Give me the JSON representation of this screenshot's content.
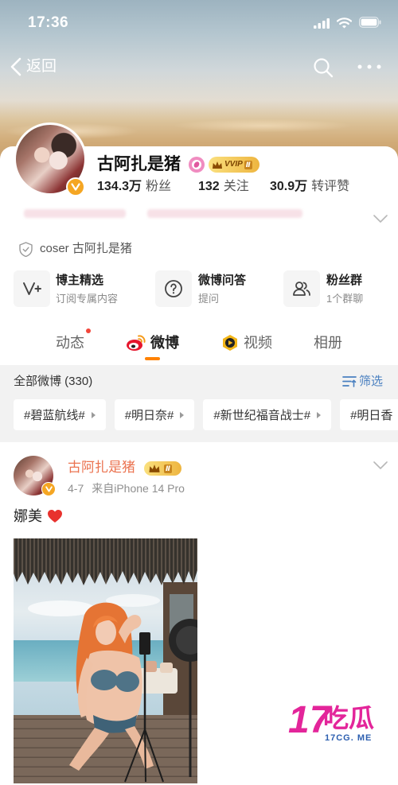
{
  "status_bar": {
    "time": "17:36",
    "icons": [
      "signal-icon",
      "wifi-icon",
      "battery-icon"
    ]
  },
  "nav": {
    "back_label": "返回",
    "icons": [
      "back-chevron-icon",
      "search-icon",
      "more-icon"
    ]
  },
  "profile": {
    "name": "古阿扎是猪",
    "vip_text": "VVIP",
    "vip_level": "Ⅱ",
    "stats": [
      {
        "value": "134.3万",
        "label": "粉丝"
      },
      {
        "value": "132",
        "label": "关注"
      },
      {
        "value": "30.9万",
        "label": "转评赞"
      }
    ],
    "verification": "coser 古阿扎是猪"
  },
  "features": [
    {
      "title": "博主精选",
      "subtitle": "订阅专属内容",
      "icon": "v-plus-icon"
    },
    {
      "title": "微博问答",
      "subtitle": "提问",
      "icon": "question-icon"
    },
    {
      "title": "粉丝群",
      "subtitle": "1个群聊",
      "icon": "group-icon"
    }
  ],
  "tabs": [
    {
      "label": "动态",
      "has_notification_dot": true
    },
    {
      "label": "微博",
      "active": true,
      "icon": "weibo-logo-icon"
    },
    {
      "label": "视频",
      "icon": "video-icon"
    },
    {
      "label": "相册"
    }
  ],
  "feed": {
    "header_title": "全部微博 (330)",
    "filter_label": "筛选",
    "topics": [
      "#碧蓝航线#",
      "#明日奈#",
      "#新世纪福音战士#",
      "#明日香"
    ]
  },
  "post": {
    "author": "古阿扎是猪",
    "vip_level": "Ⅱ",
    "date": "4-7",
    "source": "来自iPhone 14 Pro",
    "text": "娜美",
    "emoji_icon": "red-heart-icon"
  },
  "watermark": {
    "number": "17",
    "text": "吃瓜",
    "domain": "17CG. ME"
  },
  "colors": {
    "accent": "#ff8200",
    "author_name": "#eb7350",
    "link_blue": "#4a80c0",
    "verified_badge": "#f5a623",
    "vip_gold": "#eeb540",
    "watermark_pink": "#e3259a",
    "watermark_blue": "#2d5fb0"
  }
}
